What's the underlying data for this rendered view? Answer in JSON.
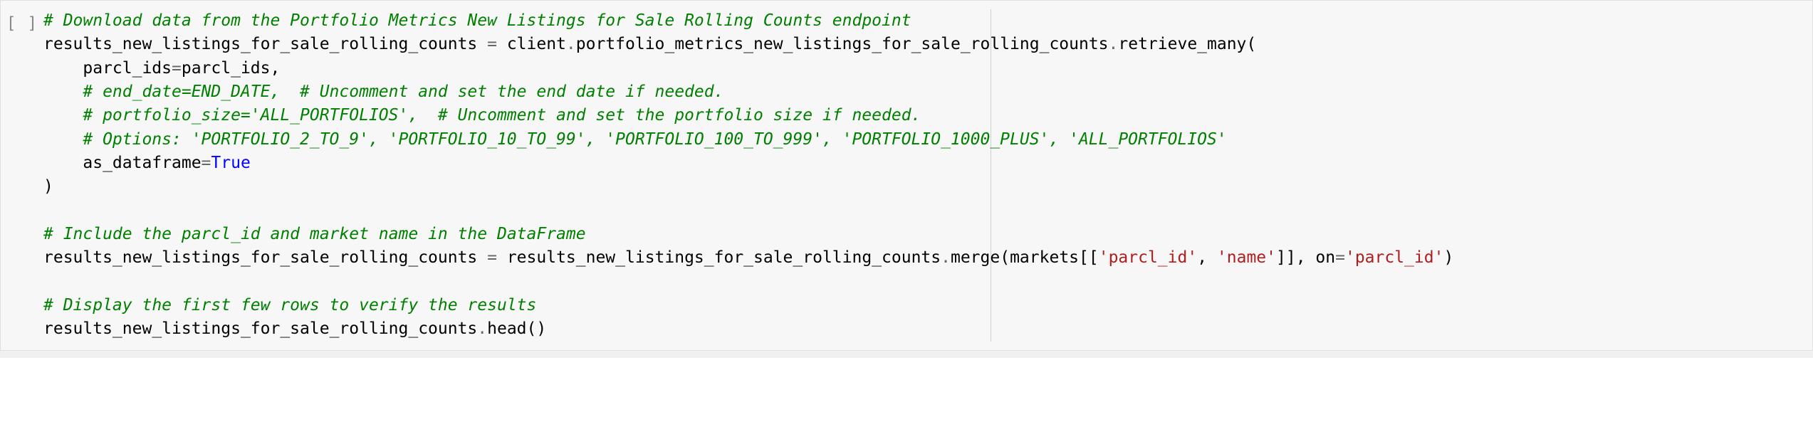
{
  "cell": {
    "execution_count": "[ ]",
    "code": {
      "line1_comment": "# Download data from the Portfolio Metrics New Listings for Sale Rolling Counts endpoint",
      "line2_left": "results_new_listings_for_sale_rolling_counts ",
      "line2_op": "=",
      "line2_right1": " client",
      "line2_dot1": ".",
      "line2_right2": "portfolio_metrics_new_listings_for_sale_rolling_counts",
      "line2_dot2": ".",
      "line2_right3": "retrieve_many",
      "line2_paren_open": "(",
      "line3_name": "parcl_ids",
      "line3_op": "=",
      "line3_val": "parcl_ids",
      "line3_comma": ",",
      "line4_comment": "# end_date=END_DATE,  # Uncomment and set the end date if needed.",
      "line5_comment": "# portfolio_size='ALL_PORTFOLIOS',  # Uncomment and set the portfolio size if needed.",
      "line6_comment": "# Options: 'PORTFOLIO_2_TO_9', 'PORTFOLIO_10_TO_99', 'PORTFOLIO_100_TO_999', 'PORTFOLIO_1000_PLUS', 'ALL_PORTFOLIOS'",
      "line7_name": "as_dataframe",
      "line7_op": "=",
      "line7_val": "True",
      "line8_paren_close": ")",
      "line10_comment": "# Include the parcl_id and market name in the DataFrame",
      "line11_left": "results_new_listings_for_sale_rolling_counts ",
      "line11_op": "=",
      "line11_r1": " results_new_listings_for_sale_rolling_counts",
      "line11_dot1": ".",
      "line11_merge": "merge",
      "line11_paren_open": "(",
      "line11_markets": "markets",
      "line11_bracket_open": "[[",
      "line11_str1": "'parcl_id'",
      "line11_comma1": ", ",
      "line11_str2": "'name'",
      "line11_bracket_close": "]]",
      "line11_comma2": ", ",
      "line11_on": "on",
      "line11_eq": "=",
      "line11_str3": "'parcl_id'",
      "line11_paren_close": ")",
      "line13_comment": "# Display the first few rows to verify the results",
      "line14_name": "results_new_listings_for_sale_rolling_counts",
      "line14_dot": ".",
      "line14_head": "head",
      "line14_parens": "()"
    }
  }
}
